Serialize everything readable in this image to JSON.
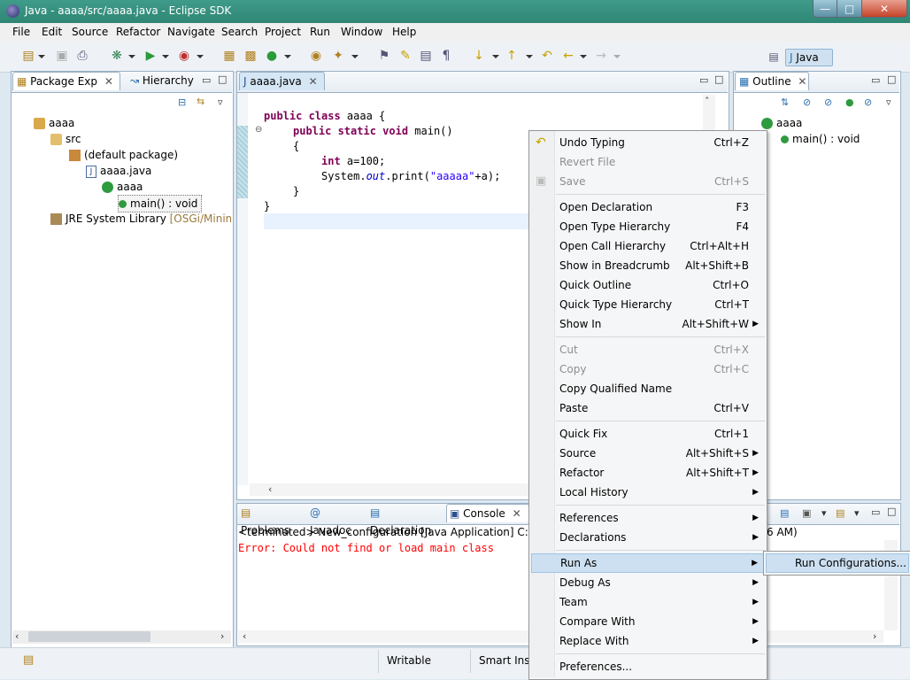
{
  "window": {
    "title": "Java - aaaa/src/aaaa.java - Eclipse SDK"
  },
  "menubar": [
    "File",
    "Edit",
    "Source",
    "Refactor",
    "Navigate",
    "Search",
    "Project",
    "Run",
    "Window",
    "Help"
  ],
  "perspective": {
    "label": "Java"
  },
  "package_explorer": {
    "tabs": [
      "Package Exp",
      "Hierarchy"
    ],
    "tree": [
      {
        "label": "aaaa"
      },
      {
        "label": "src"
      },
      {
        "label": "(default package)"
      },
      {
        "label": "aaaa.java"
      },
      {
        "label": "aaaa"
      },
      {
        "label": "main() : void"
      }
    ],
    "jre": {
      "label": "JRE System Library",
      "suffix": "[OSGi/Minimun"
    }
  },
  "editor": {
    "tab": "aaaa.java",
    "code": {
      "l1_kw": "public class",
      "l1_rest": " aaaa {",
      "l2_kw": "public static void",
      "l2_rest": " main()",
      "l3": "{",
      "l4_kw": "int",
      "l4_rest": " a=100;",
      "l5_a": "System.",
      "l5_out": "out",
      "l5_b": ".print(",
      "l5_str": "\"aaaaa\"",
      "l5_c": "+a);",
      "l6": "}",
      "l7": "}"
    }
  },
  "outline": {
    "tab": "Outline",
    "items": [
      {
        "label": "aaaa"
      },
      {
        "label": "main() : void"
      }
    ]
  },
  "console": {
    "tabs": [
      "Problems",
      "Javadoc",
      "Declaration",
      "Console"
    ],
    "status_line": "<terminated> New_configuration [Java Application] C:\\Progra",
    "status_tail": "6 AM)",
    "error": "Error: Could not find or load main class"
  },
  "context_menu": {
    "items": [
      {
        "label": "Undo Typing",
        "shortcut": "Ctrl+Z"
      },
      {
        "label": "Revert File",
        "shortcut": ""
      },
      {
        "label": "Save",
        "shortcut": "Ctrl+S"
      },
      {
        "label": "Open Declaration",
        "shortcut": "F3"
      },
      {
        "label": "Open Type Hierarchy",
        "shortcut": "F4"
      },
      {
        "label": "Open Call Hierarchy",
        "shortcut": "Ctrl+Alt+H"
      },
      {
        "label": "Show in Breadcrumb",
        "shortcut": "Alt+Shift+B"
      },
      {
        "label": "Quick Outline",
        "shortcut": "Ctrl+O"
      },
      {
        "label": "Quick Type Hierarchy",
        "shortcut": "Ctrl+T"
      },
      {
        "label": "Show In",
        "shortcut": "Alt+Shift+W"
      },
      {
        "label": "Cut",
        "shortcut": "Ctrl+X"
      },
      {
        "label": "Copy",
        "shortcut": "Ctrl+C"
      },
      {
        "label": "Copy Qualified Name",
        "shortcut": ""
      },
      {
        "label": "Paste",
        "shortcut": "Ctrl+V"
      },
      {
        "label": "Quick Fix",
        "shortcut": "Ctrl+1"
      },
      {
        "label": "Source",
        "shortcut": "Alt+Shift+S"
      },
      {
        "label": "Refactor",
        "shortcut": "Alt+Shift+T"
      },
      {
        "label": "Local History",
        "shortcut": ""
      },
      {
        "label": "References",
        "shortcut": ""
      },
      {
        "label": "Declarations",
        "shortcut": ""
      },
      {
        "label": "Run As",
        "shortcut": ""
      },
      {
        "label": "Debug As",
        "shortcut": ""
      },
      {
        "label": "Team",
        "shortcut": ""
      },
      {
        "label": "Compare With",
        "shortcut": ""
      },
      {
        "label": "Replace With",
        "shortcut": ""
      },
      {
        "label": "Preferences...",
        "shortcut": ""
      }
    ],
    "submenu": {
      "label": "Run Configurations..."
    }
  },
  "statusbar": {
    "writable": "Writable",
    "insert": "Smart Inse"
  },
  "colors": {
    "title_bar": "#2f8674",
    "error_text": "#ff0000",
    "menu_highlight": "#cde0f1"
  }
}
